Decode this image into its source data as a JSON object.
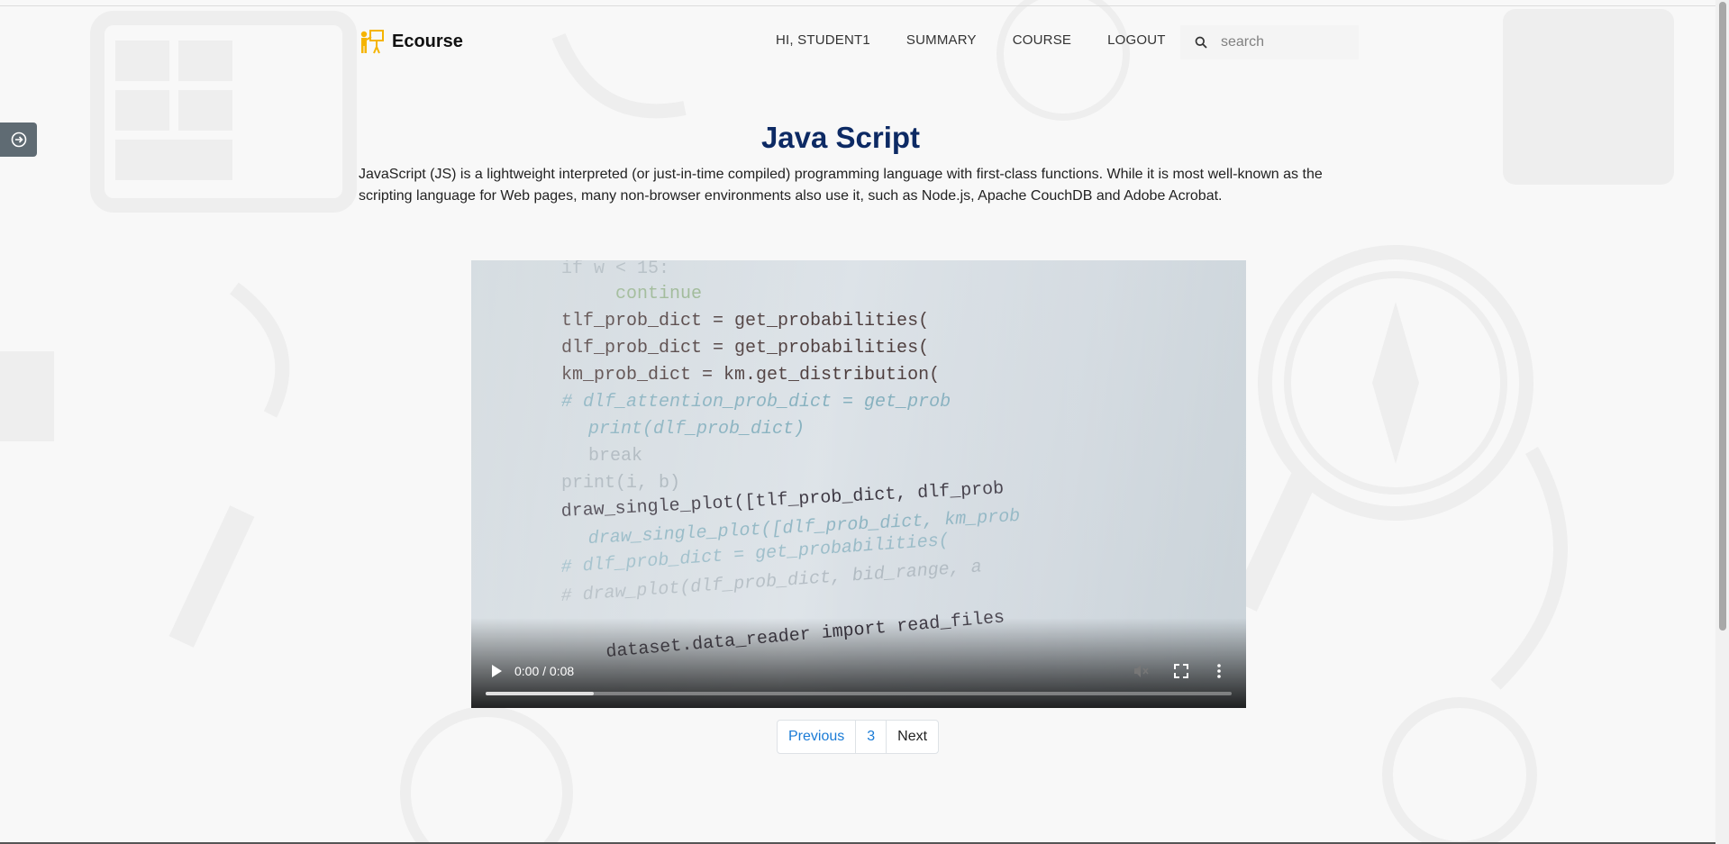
{
  "brand": {
    "name": "Ecourse",
    "icon": "teacher-board-icon",
    "icon_color": "#f5b400"
  },
  "nav": {
    "greeting": "HI, STUDENT1",
    "items": [
      {
        "label": "SUMMARY"
      },
      {
        "label": "COURSE"
      },
      {
        "label": "LOGOUT"
      }
    ],
    "search_placeholder": "search"
  },
  "sidebar_toggle": {
    "icon": "arrow-circle-right-icon"
  },
  "lesson": {
    "title": "Java Script",
    "description": "JavaScript (JS) is a lightweight interpreted (or just-in-time compiled) programming language with first-class functions. While it is most well-known as the scripting language for Web pages, many non-browser environments also use it, such as Node.js, Apache CouchDB and Adobe Acrobat."
  },
  "video": {
    "time": "0:00 / 0:08",
    "buffered_fraction": 0.145,
    "code_lines": [
      "if w < 15:",
      "continue",
      "tlf_prob_dict = get_probabilities(",
      "dlf_prob_dict = get_probabilities(",
      "km_prob_dict = km.get_distribution(",
      "# dlf_attention_prob_dict = get_prob",
      "print(dlf_prob_dict)",
      "break",
      "print(i, b)",
      "draw_single_plot([tlf_prob_dict, dlf_prob",
      "draw_single_plot([dlf_prob_dict, km_prob",
      "# dlf_prob_dict = get_probabilities(",
      "# draw_plot(dlf_prob_dict, bid_range, a",
      "dataset.data_reader import read_files"
    ]
  },
  "pagination": {
    "previous": "Previous",
    "current": "3",
    "next": "Next"
  },
  "colors": {
    "title": "#0d2a64",
    "link": "#1a7bd6",
    "background": "#f8f8f8"
  }
}
